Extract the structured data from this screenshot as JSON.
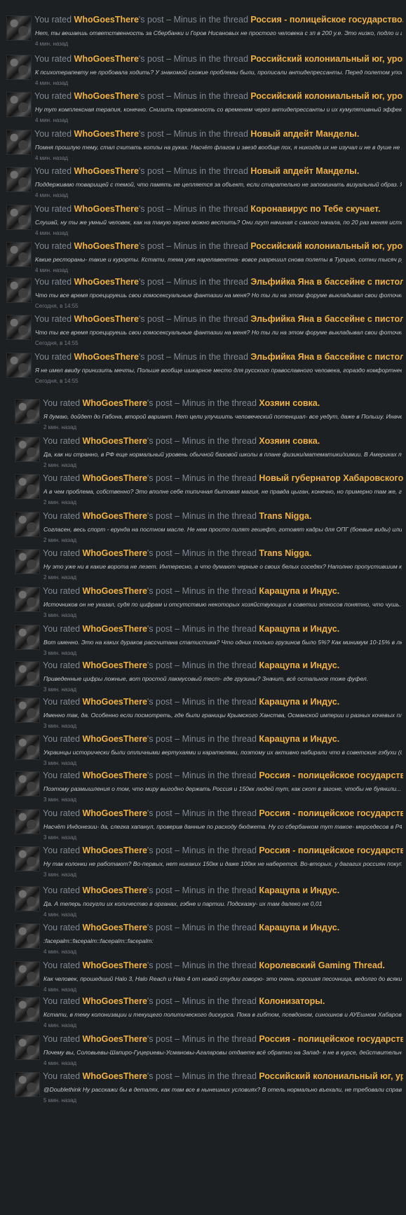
{
  "labels": {
    "prefix": "You rated",
    "possessive": "'s post",
    "rating": "– Minus",
    "in_thread": "in the thread",
    "dot": "."
  },
  "items": [
    {
      "user": "WhoGoesThere",
      "thread": "Россия - полицейское государство.",
      "snippet": "Нет, ты вешаешь ответственность за Сбербанки и Горов Нисановых не простого человека с зп в 200 у.е. Это низко, подло и глупо. А ты...",
      "time": "4 мин. назад"
    },
    {
      "user": "WhoGoesThere",
      "thread": "Российский колониальный юг, уровня 0.",
      "snippet": "К психотерапевту не пробовала ходить? У знакомой схожие проблемы были, прописали антидепрессанты. Перед полетом употребляешь препарат с...",
      "time": "4 мин. назад"
    },
    {
      "user": "WhoGoesThere",
      "thread": "Российский колониальный юг, уровня 0.",
      "snippet": "Ну тут комплексная терапия, конечно. Снизить тревожность со временем через антидепрессанты и их кумулятивный эффект, бенко же сразу...",
      "time": "4 мин. назад"
    },
    {
      "user": "WhoGoesThere",
      "thread": "Новый апдейт Манделы.",
      "snippet": "Помня прошлую тему, стал считать котлы на руках. Насчёт флагов и звезд вообще пох, я никогда их не изучал и не в душе не знаю, сколько...",
      "time": "4 мин. назад"
    },
    {
      "user": "WhoGoesThere",
      "thread": "Новый апдейт Манделы.",
      "snippet": "Поддерживаю товарищей с темой, что память не цепляется за объект, если старательно не запоминать визуальный образ. Я флаг СССР видел по...",
      "time": "4 мин. назад"
    },
    {
      "user": "WhoGoesThere",
      "thread": "Коронавирус по Тебе скучает.",
      "snippet": "Слушай, ну ты же умный человек, как на такую херню можно вестить? Они лгут начиная с самого начала, по 20 раз меняя историю. Ты помнишь...",
      "time": "4 мин. назад"
    },
    {
      "user": "WhoGoesThere",
      "thread": "Российский колониальный юг, уровня 0.",
      "snippet": "Какие рестораны- такие и курорты. Кстати, тема уже нарелавентна- вовсе разрешил снова полеты в Турцию, сотни тысяч русских напеш ликуют,...",
      "time": "4 мин. назад"
    },
    {
      "user": "WhoGoesThere",
      "thread": "Эльфийка Яна в бассейне с пистолетиком.",
      "snippet": "Что ты все время проецируешь свои гомосексуальные фантазии на меня? Но ты ли на этом форуме выкладывал свои фоточки спины? Ты же кочка?...",
      "time": "Сегодня, в 14:55"
    },
    {
      "user": "WhoGoesThere",
      "thread": "Эльфийка Яна в бассейне с пистолетиком.",
      "snippet": "Что ты все время проецируешь свои гомосексуальные фантазии на меня? Но ты ли на этом форуме выкладывал свои фоточки спины? Ты же кочка?...",
      "time": "Сегодня, в 14:55"
    },
    {
      "user": "WhoGoesThere",
      "thread": "Эльфийка Яна в бассейне с пистолетиком.",
      "snippet": "Я не имел ввиду принизить мечты, Польше вообще шикарное место для русского православного человека, гораздо комфортнее Эстонии, Венгрии,...",
      "time": "Сегодня, в 14:55"
    },
    {
      "user": "WhoGoesThere",
      "thread": "Хозяин совка.",
      "snippet": "Я думаю, дойдет до Габона, второй вариант. Нет цели улучшить человеческий потенциал- все уедут, даже в Польшу. Иначе для чего все эта...",
      "time": "2 мин. назад"
    },
    {
      "user": "WhoGoesThere",
      "thread": "Хозяин совка.",
      "snippet": "Да, как ни странно, в РФ еще нормальный уровень обычной базовой школы в плане физики/математики/химии. В Америках такое только в частных...",
      "time": "2 мин. назад"
    },
    {
      "user": "WhoGoesThere",
      "thread": "Новый губернатор Хабаровского края.",
      "snippet": "А в чем проблема, собственно? Это вполне себе типичная бытовая магия, не правда цыган, конечно, но примерно там же, где \"подкову...",
      "time": "2 мин. назад"
    },
    {
      "user": "WhoGoesThere",
      "thread": "Trans Nigga.",
      "snippet": "Согласен, весь спорт - ерунда на постном масле. Не нем просто пилят гешефт, готовят кадры для ОПГ (боевые виды) или...",
      "time": "2 мин. назад"
    },
    {
      "user": "WhoGoesThere",
      "thread": "Trans Nigga.",
      "snippet": "Ну это уже ни в какие ворота не лезет. Интересно, а что думают черные о своих белых соседях? Наполню пропустившим курсы истории, белаки...",
      "time": "2 мин. назад"
    },
    {
      "user": "WhoGoesThere",
      "thread": "Карацупа и Индус.",
      "snippet": "Источников он не указал, судя по цифрам и отсутствию некоторых хозяйствующих в советии этносов понятно, что чушь. Вот тебе тоже...",
      "time": "3 мин. назад"
    },
    {
      "user": "WhoGoesThere",
      "thread": "Карацупа и Индус.",
      "snippet": "Вот именно. Это на каких дураков рассчитана статистика? Что одних только грузинов было 5%? Как минимум 10-15% в любой период с 24-37,...",
      "time": "3 мин. назад"
    },
    {
      "user": "WhoGoesThere",
      "thread": "Карацупа и Индус.",
      "snippet": "Приведенные цифры ложные, вот простой лакмусовый тест- где грузины? Значит, всё остальное тоже фуфел.",
      "time": "3 мин. назад"
    },
    {
      "user": "WhoGoesThere",
      "thread": "Карацупа и Индус.",
      "snippet": "Именно так, да. Особенно если посмотреть, где были границы Крымского Ханства, Османской империи и разных кочевых племен. Я уже давно тут...",
      "time": "3 мин. назад"
    },
    {
      "user": "WhoGoesThere",
      "thread": "Карацупа и Индус.",
      "snippet": "Украинцы исторически были отличными вертухаями и карателями, поэтому их активно набирали что в советские гэбухи (до 50% состава было...",
      "time": "3 мин. назад"
    },
    {
      "user": "WhoGoesThere",
      "thread": "Россия - полицейское государство.",
      "snippet": "Поэтому размышления о том, что миру выгодно держать Россия и 150кк людей тут, как скот в загоне, чтобы не буянили... как минимум нелепы...",
      "time": "3 мин. назад"
    },
    {
      "user": "WhoGoesThere",
      "thread": "Россия - полицейское государство.",
      "snippet": "Насчёт Индонезии- да, слегка хапанул, проверив данные по расходу бюджета. Ну со сбербанком тут такое- мерседесов в РФии тоже продается...",
      "time": "3 мин. назад"
    },
    {
      "user": "WhoGoesThere",
      "thread": "Россия - полицейское государство.",
      "snippet": "Ну так колонки не работают? Во-первых, нет никаких 150кк и даже 100кк не наберется. Во-вторых, у дагагих россиян покупательская...",
      "time": "3 мин. назад"
    },
    {
      "user": "WhoGoesThere",
      "thread": "Карацупа и Индус.",
      "snippet": "Да. А теперь погугли их количество в органах, гэбне и партии. Подсказку- их там далеко не 0,01",
      "time": "4 мин. назад"
    },
    {
      "user": "WhoGoesThere",
      "thread": "Карацупа и Индус.",
      "snippet": ":facepalm::facepalm::facepalm::facepalm:",
      "time": "4 мин. назад"
    },
    {
      "user": "WhoGoesThere",
      "thread": "Королевский Gaming Thread.",
      "snippet": "Как человек, прошедший Halo 3, Halo Reach и Halo 4 от новой студии говорю- это очень хорошая песочница, ведолго до всяких крузисов...",
      "time": "4 мин. назад"
    },
    {
      "user": "WhoGoesThere",
      "thread": "Колонизаторы.",
      "snippet": "Кстати, в тему колонизации и текущего политического дискурса. Пока в гибтом, псевдоном, синошнов и АУЕшном Хабаровске проходят...",
      "time": "4 мин. назад"
    },
    {
      "user": "WhoGoesThere",
      "thread": "Россия - полицейское государство.",
      "snippet": "Почему вы, Соловьевы-Шапиро-Гуцериевы-Усмановы-Агаларовы отдаете всё обратно на Запад- я не в курсе, действительно, зачем ты отдаешь?...",
      "time": "4 мин. назад"
    },
    {
      "user": "WhoGoesThere",
      "thread": "Российский колониальный юг, уровня 0.",
      "snippet": "@Doublethink Ну расскажи бы в деталях, как там все в нынешних условиях? В отель нормально въехали, не требовали справок? Что с толпами...",
      "time": "5 мин. назад"
    }
  ]
}
